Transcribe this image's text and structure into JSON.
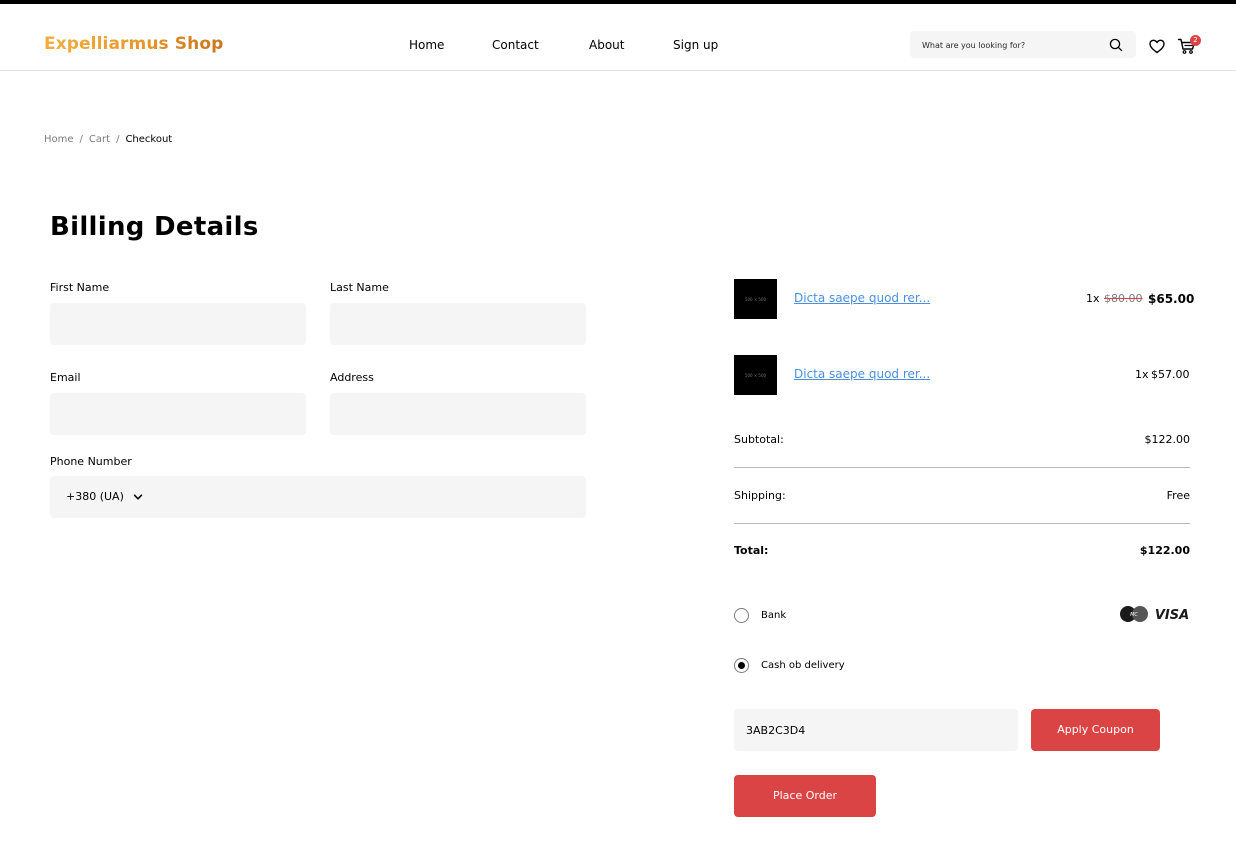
{
  "header": {
    "brand": "Expelliarmus Shop",
    "nav": [
      "Home",
      "Contact",
      "About",
      "Sign up"
    ],
    "search_placeholder": "What are you looking for?",
    "cart_count": "2"
  },
  "breadcrumb": {
    "items": [
      "Home",
      "Cart"
    ],
    "current": "Checkout"
  },
  "billing": {
    "title": "Billing Details",
    "first_name_label": "First Name",
    "last_name_label": "Last Name",
    "email_label": "Email",
    "address_label": "Address",
    "phone_label": "Phone Number",
    "phone_code": "+380 (UA)"
  },
  "order": {
    "items": [
      {
        "thumb": "500 × 500",
        "name": "Dicta saepe quod rer...",
        "qty": "1x",
        "old_price": "$80.00",
        "price": "$65.00"
      },
      {
        "thumb": "500 × 500",
        "name": "Dicta saepe quod rer...",
        "qty": "1x",
        "price": "$57.00"
      }
    ],
    "subtotal_label": "Subtotal:",
    "subtotal": "$122.00",
    "shipping_label": "Shipping:",
    "shipping": "Free",
    "total_label": "Total:",
    "total": "$122.00",
    "payment": {
      "bank": "Bank",
      "cod": "Cash ob delivery",
      "selected": "cod"
    },
    "coupon_value": "3AB2C3D4",
    "apply_label": "Apply Coupon",
    "place_order_label": "Place Order"
  },
  "colors": {
    "accent": "#db4444",
    "link": "#4a90e2",
    "brand_start": "#f3ad3c",
    "brand_end": "#c9741b",
    "field_bg": "#f5f5f5"
  }
}
